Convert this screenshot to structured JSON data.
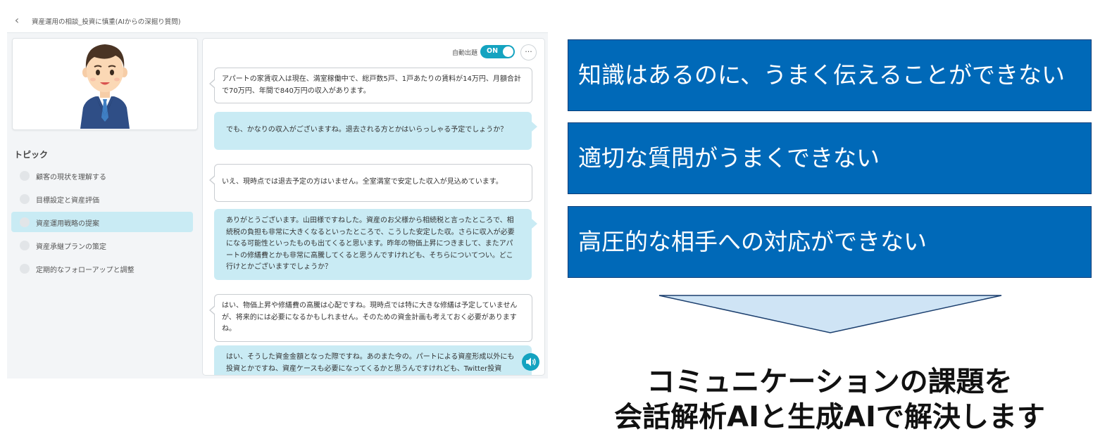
{
  "app": {
    "header": {
      "title": "資産運用の相談_投資に慎重(AIからの深掘り質問)"
    },
    "sidebar": {
      "heading": "トピック",
      "topics": [
        {
          "label": "顧客の現状を理解する",
          "active": false
        },
        {
          "label": "目標設定と資産評価",
          "active": false
        },
        {
          "label": "資産運用戦略の提案",
          "active": true
        },
        {
          "label": "資産承継プランの策定",
          "active": false
        },
        {
          "label": "定期的なフォローアップと調整",
          "active": false
        }
      ]
    },
    "chat": {
      "auto_question_label": "自動出題",
      "toggle_label": "ON",
      "more_label": "···",
      "messages": [
        {
          "role": "customer",
          "text": "アパートの家賃収入は現在、満室稼働中で、総戸数5戸、1戸あたりの賃料が14万円、月額合計で70万円、年間で840万円の収入があります。"
        },
        {
          "role": "agent",
          "text": "でも、かなりの収入がございますね。退去される方とかはいらっしゃる予定でしょうか？"
        },
        {
          "role": "customer",
          "text": "いえ、現時点では退去予定の方はいません。全室満室で安定した収入が見込めています。"
        },
        {
          "role": "agent",
          "text": "ありがとうございます。山田様ですねした。資産のお父様から相続税と言ったところで、相続税の負担も非常に大きくなるといったところで、こうした安定した収。さらに収入が必要になる可能性といったものも出てくると思います。昨年の物価上昇につきまして、またアパートの修繕費とかも非常に高騰してくると思うんですけれども、そちらについてつい。どこ行けとかございますでしょうか？"
        },
        {
          "role": "customer",
          "text": "はい、物価上昇や修繕費の高騰は心配ですね。現時点では特に大きな修繕は予定していませんが、将来的には必要になるかもしれません。そのための資金計画も考えておく必要がありますね。"
        },
        {
          "role": "agent",
          "text": "はい、そうした資金金額となった際ですね。あのまた今の。パートによる資産形成以外にも投資とかですね、資産ケースも必要になってくるかと思うんですけれども、Twitter投資"
        }
      ]
    }
  },
  "issues": [
    "知識はあるのに、うまく伝えることができない",
    "適切な質問がうまくできない",
    "高圧的な相手への対応ができない"
  ],
  "conclusion": {
    "line1": "コミュニケーションの課題を",
    "line2": "会話解析AIと生成AIで解決します"
  },
  "colors": {
    "issue_box": "#0069b8",
    "issue_border": "#0a3d78",
    "agent_bubble": "#c9ebf4",
    "toggle": "#14a3c0",
    "arrow_fill": "#cfe4f5"
  }
}
